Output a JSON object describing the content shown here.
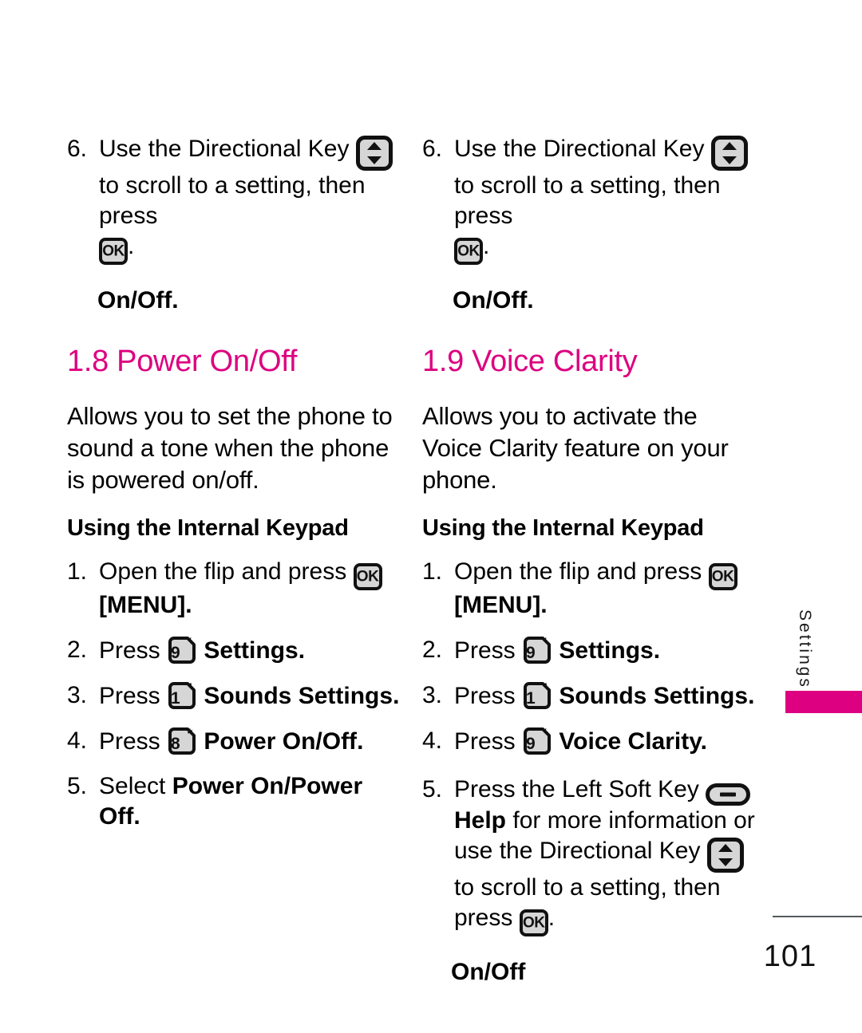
{
  "document": {
    "page_number": "101",
    "side_tab_label": "Settings",
    "accent_color": "#DD0080",
    "key_fill_color": "#d6d6d6"
  },
  "icons": {
    "ok_key": {
      "name": "ok-key-icon",
      "label": "OK"
    },
    "directional_key": {
      "name": "directional-key-icon",
      "label": "Directional Key"
    },
    "soft_key": {
      "name": "left-soft-key-icon",
      "label": "Left Soft Key"
    },
    "key_9": {
      "name": "keypad-9-icon",
      "digit": "9",
      "superscript": "‘"
    },
    "key_1": {
      "name": "keypad-1-icon",
      "digit": "1",
      "superscript": "’"
    },
    "key_8": {
      "name": "keypad-8-icon",
      "digit": "8",
      "superscript": "*"
    }
  },
  "left_column": {
    "carryover_step": {
      "number": "6.",
      "text_part1": "Use the Directional Key",
      "text_part2": "to scroll to a setting, then press",
      "text_part3": "."
    },
    "carryover_onoff": "On/Off.",
    "section": {
      "title": "1.8 Power On/Off",
      "description": "Allows you to set the phone to sound a tone when the phone is powered on/off.",
      "subhead": "Using the Internal Keypad",
      "steps": [
        {
          "number": "1.",
          "before": "Open the flip and press",
          "after": "[MENU]."
        },
        {
          "number": "2.",
          "before": "Press",
          "bold": "Settings",
          "after": "."
        },
        {
          "number": "3.",
          "before": "Press",
          "bold": "Sounds Settings",
          "after": "."
        },
        {
          "number": "4.",
          "before": "Press",
          "bold": "Power On/Off",
          "after": "."
        },
        {
          "number": "5.",
          "before": "Select",
          "bold": "Power On/Power Off",
          "after": "."
        }
      ]
    }
  },
  "right_column": {
    "carryover_step": {
      "number": "6.",
      "text_part1": "Use the Directional Key",
      "text_part2": "to scroll to a setting, then press",
      "text_part3": "."
    },
    "carryover_onoff": "On/Off.",
    "section": {
      "title": "1.9 Voice Clarity",
      "description": "Allows you to activate the Voice Clarity feature on your phone.",
      "subhead": "Using the Internal Keypad",
      "steps": [
        {
          "number": "1.",
          "before": "Open the flip and press",
          "after": "[MENU]."
        },
        {
          "number": "2.",
          "before": "Press",
          "bold": "Settings",
          "after": "."
        },
        {
          "number": "3.",
          "before": "Press",
          "bold": "Sounds Settings",
          "after": "."
        },
        {
          "number": "4.",
          "before": "Press",
          "bold": "Voice Clarity",
          "after": "."
        }
      ],
      "step5": {
        "number": "5.",
        "part1": "Press the Left Soft Key",
        "bold_help": "Help",
        "part2": "for more information or use the Directional Key",
        "part3": "to scroll to a setting, then press",
        "part4": "."
      },
      "final_onoff": "On/Off"
    }
  }
}
